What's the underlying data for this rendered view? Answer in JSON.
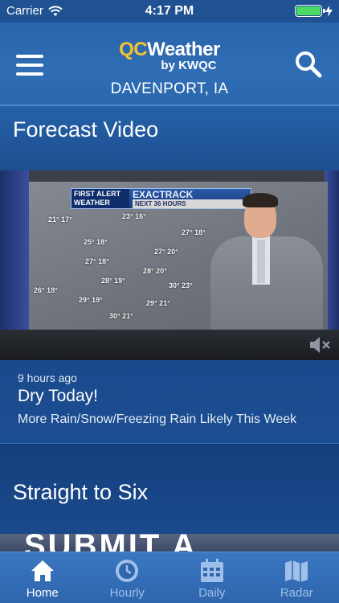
{
  "status_bar": {
    "carrier": "Carrier",
    "time": "4:17 PM",
    "battery_level": 1.0,
    "battery_color": "#4cd964"
  },
  "header": {
    "logo_qc": "QC",
    "logo_weather": "Weather",
    "logo_sub": "by KWQC",
    "location": "DAVENPORT, IA",
    "menu_icon": "hamburger-menu-icon",
    "search_icon": "magnifier-icon"
  },
  "forecast_video": {
    "title": "Forecast Video",
    "banner": {
      "badge_line1": "FIRST ALERT",
      "badge_line2": "WEATHER",
      "title": "EXACTRACK",
      "subtitle": "NEXT 36 HOURS"
    },
    "map_temps": [
      "21° 17°",
      "23° 16°",
      "25° 18°",
      "27° 18°",
      "27° 20°",
      "27° 18°",
      "28° 19°",
      "28° 20°",
      "30° 23°",
      "26° 18°",
      "29° 19°",
      "29° 21°",
      "30° 21°"
    ]
  },
  "article": {
    "time": "9 hours ago",
    "title": "Dry Today!",
    "summary": "More Rain/Snow/Freezing Rain Likely This Week"
  },
  "straight_to_six": {
    "title": "Straight to Six",
    "promo_text": "SUBMIT A WEATHER"
  },
  "tabs": [
    {
      "label": "Home",
      "icon": "home-icon",
      "active": true
    },
    {
      "label": "Hourly",
      "icon": "clock-icon",
      "active": false
    },
    {
      "label": "Daily",
      "icon": "calendar-icon",
      "active": false
    },
    {
      "label": "Radar",
      "icon": "map-icon",
      "active": false
    }
  ],
  "colors": {
    "accent_yellow": "#f4c430",
    "header_blue": "#2f6db5",
    "tab_active": "#ffffff",
    "tab_inactive": "#9fc0ea"
  }
}
